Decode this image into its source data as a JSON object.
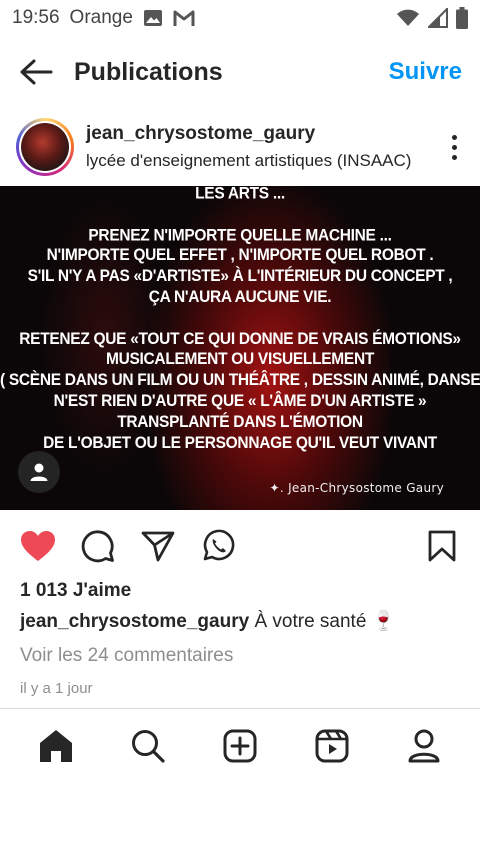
{
  "status_bar": {
    "time": "19:56",
    "carrier": "Orange",
    "icons": [
      "image-icon",
      "gmail-icon",
      "wifi-icon",
      "signal-icon",
      "battery-icon"
    ]
  },
  "header": {
    "title": "Publications",
    "follow_label": "Suivre"
  },
  "post": {
    "username": "jean_chrysostome_gaury",
    "location": "lycée d'enseignement artistiques (INSAAC)",
    "image_text": {
      "lines": [
        "LES ARTS ...",
        "",
        "PRENEZ N'IMPORTE QUELLE MACHINE ...",
        "N'IMPORTE QUEL EFFET , N'IMPORTE QUEL ROBOT .",
        "S'IL N'Y A PAS «D'ARTISTE» À L'INTÉRIEUR DU CONCEPT ,",
        "ÇA N'AURA AUCUNE VIE.",
        "",
        "RETENEZ QUE «TOUT CE QUI DONNE DE VRAIS ÉMOTIONS»",
        "MUSICALEMENT OU  VISUELLEMENT",
        "( SCÈNE DANS UN FILM OU UN THÉÂTRE , DESSIN ANIMÉ, DANSE ,PEINTURE ETC )",
        "N'EST RIEN D'AUTRE QUE « L'ÂME D'UN ARTISTE »",
        "TRANSPLANTÉ DANS L'ÉMOTION",
        "DE L'OBJET OU LE PERSONNAGE QU'IL VEUT VIVANT"
      ],
      "signature": "✦. Jean-Chrysostome Gaury"
    },
    "likes": "1 013 J'aime",
    "caption_user": "jean_chrysostome_gaury",
    "caption_text": "À votre santé 🍷",
    "comments_link": "Voir les 24 commentaires",
    "time_ago": "il y a 1 jour",
    "liked": true
  },
  "colors": {
    "accent": "#0095f6",
    "like_red": "#ed4956",
    "text": "#262626",
    "muted": "#8e8e8e"
  },
  "bottom_nav": [
    "home-icon",
    "search-icon",
    "add-post-icon",
    "reels-icon",
    "profile-icon"
  ]
}
